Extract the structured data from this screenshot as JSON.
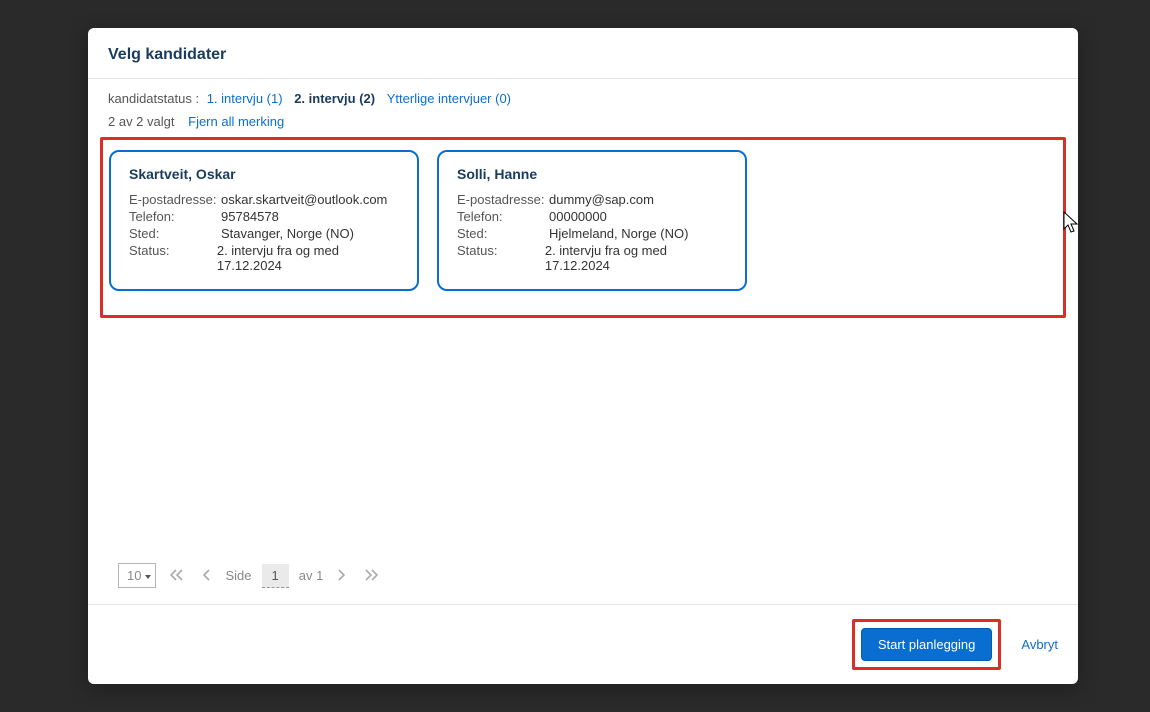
{
  "modal": {
    "title": "Velg kandidater"
  },
  "status": {
    "label": "kandidatstatus :",
    "tabs": [
      {
        "label": "1. intervju (1)",
        "active": false
      },
      {
        "label": "2. intervju (2)",
        "active": true
      },
      {
        "label": "Ytterlige intervjuer (0)",
        "active": false
      }
    ]
  },
  "selection": {
    "summary": "2 av 2 valgt",
    "clear_label": "Fjern all merking"
  },
  "field_labels": {
    "email": "E-postadresse:",
    "phone": "Telefon:",
    "place": "Sted:",
    "status": "Status:"
  },
  "candidates": [
    {
      "name": "Skartveit, Oskar",
      "email": "oskar.skartveit@outlook.com",
      "phone": "95784578",
      "place": "Stavanger, Norge (NO)",
      "status": "2. intervju fra og med 17.12.2024"
    },
    {
      "name": "Solli, Hanne",
      "email": "dummy@sap.com",
      "phone": "00000000",
      "place": "Hjelmeland, Norge (NO)",
      "status": "2. intervju fra og med 17.12.2024"
    }
  ],
  "pager": {
    "size": "10",
    "side_label": "Side",
    "current": "1",
    "of_label": "av 1"
  },
  "footer": {
    "primary": "Start planlegging",
    "cancel": "Avbryt"
  }
}
